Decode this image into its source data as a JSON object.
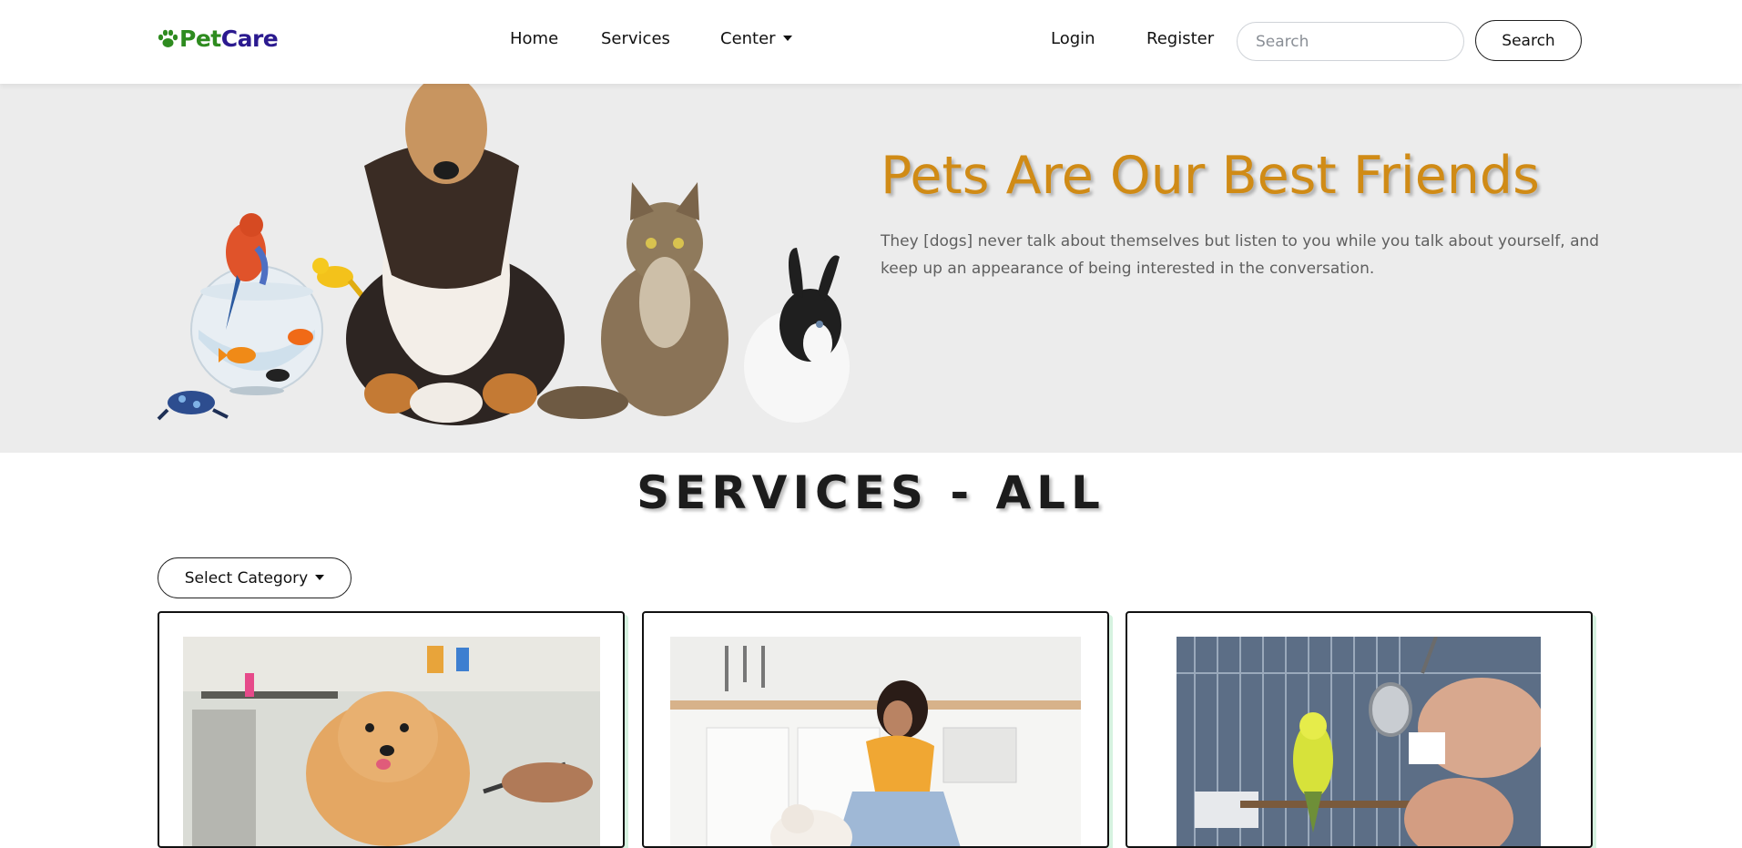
{
  "brand": {
    "name_part1": "Pet",
    "name_part2": "Care",
    "colors": {
      "pet": "#2e8b1f",
      "care": "#2b1a8f"
    }
  },
  "nav": {
    "home": "Home",
    "services": "Services",
    "center": "Center",
    "login": "Login",
    "register": "Register",
    "search_placeholder": "Search",
    "search_button": "Search"
  },
  "hero": {
    "title": "Pets Are Our Best Friends",
    "quote": "They [dogs] never talk about themselves but listen to you while you talk about yourself, and keep up an appearance of being interested in the conversation.",
    "accent_color": "#d08b16"
  },
  "services": {
    "title": "SERVICES - ALL",
    "category_button": "Select Category"
  }
}
